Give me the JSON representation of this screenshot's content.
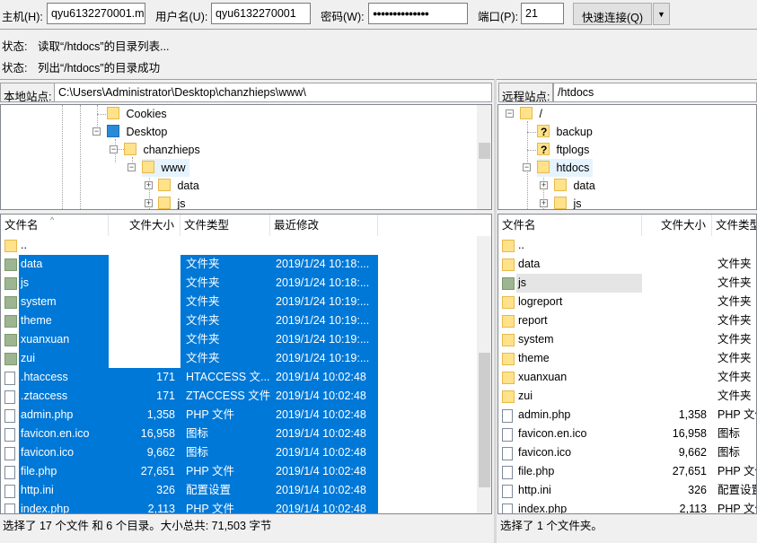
{
  "quickconnect": {
    "host_label": "主机(H):",
    "host_value": "qyu6132270001.m",
    "user_label": "用户名(U):",
    "user_value": "qyu6132270001",
    "pass_label": "密码(W):",
    "pass_value": "●●●●●●●●●●●●●●",
    "port_label": "端口(P):",
    "port_value": "21",
    "connect_button": "快速连接(Q)",
    "dropdown_glyph": "▼"
  },
  "log": [
    {
      "label": "状态:",
      "text": "读取“/htdocs”的目录列表..."
    },
    {
      "label": "状态:",
      "text": "列出“/htdocs”的目录成功"
    }
  ],
  "local": {
    "site_label": "本地站点:",
    "site_path": "C:\\Users\\Administrator\\Desktop\\chanzhieps\\www\\",
    "tree": [
      {
        "name": "Cookies",
        "icon": "folder"
      },
      {
        "name": "Desktop",
        "icon": "folder-blue"
      },
      {
        "name": "chanzhieps",
        "icon": "folder"
      },
      {
        "name": "www",
        "icon": "folder"
      },
      {
        "name": "data",
        "icon": "folder"
      },
      {
        "name": "js",
        "icon": "folder"
      }
    ],
    "columns": [
      "文件名",
      "文件大小",
      "文件类型",
      "最近修改"
    ],
    "files": [
      {
        "name": "..",
        "size": "",
        "type": "",
        "modified": "",
        "icon": "folder",
        "selected": false
      },
      {
        "name": "data",
        "size": "",
        "type": "文件夹",
        "modified": "2019/1/24 10:18:...",
        "icon": "folder-green",
        "selected": true
      },
      {
        "name": "js",
        "size": "",
        "type": "文件夹",
        "modified": "2019/1/24 10:18:...",
        "icon": "folder-green",
        "selected": true
      },
      {
        "name": "system",
        "size": "",
        "type": "文件夹",
        "modified": "2019/1/24 10:19:...",
        "icon": "folder-green",
        "selected": true
      },
      {
        "name": "theme",
        "size": "",
        "type": "文件夹",
        "modified": "2019/1/24 10:19:...",
        "icon": "folder-green",
        "selected": true
      },
      {
        "name": "xuanxuan",
        "size": "",
        "type": "文件夹",
        "modified": "2019/1/24 10:19:...",
        "icon": "folder-green",
        "selected": true
      },
      {
        "name": "zui",
        "size": "",
        "type": "文件夹",
        "modified": "2019/1/24 10:19:...",
        "icon": "folder-green",
        "selected": true
      },
      {
        "name": ".htaccess",
        "size": "171",
        "type": "HTACCESS 文...",
        "modified": "2019/1/4 10:02:48",
        "icon": "file",
        "selected": true
      },
      {
        "name": ".ztaccess",
        "size": "171",
        "type": "ZTACCESS 文件",
        "modified": "2019/1/4 10:02:48",
        "icon": "file",
        "selected": true
      },
      {
        "name": "admin.php",
        "size": "1,358",
        "type": "PHP 文件",
        "modified": "2019/1/4 10:02:48",
        "icon": "file",
        "selected": true
      },
      {
        "name": "favicon.en.ico",
        "size": "16,958",
        "type": "图标",
        "modified": "2019/1/4 10:02:48",
        "icon": "file",
        "selected": true
      },
      {
        "name": "favicon.ico",
        "size": "9,662",
        "type": "图标",
        "modified": "2019/1/4 10:02:48",
        "icon": "file",
        "selected": true
      },
      {
        "name": "file.php",
        "size": "27,651",
        "type": "PHP 文件",
        "modified": "2019/1/4 10:02:48",
        "icon": "file",
        "selected": true
      },
      {
        "name": "http.ini",
        "size": "326",
        "type": "配置设置",
        "modified": "2019/1/4 10:02:48",
        "icon": "file",
        "selected": true
      },
      {
        "name": "index.php",
        "size": "2,113",
        "type": "PHP 文件",
        "modified": "2019/1/4 10:02:48",
        "icon": "file",
        "selected": true
      }
    ],
    "status": "选择了 17 个文件 和 6 个目录。大小总共: 71,503 字节"
  },
  "remote": {
    "site_label": "远程站点:",
    "site_path": "/htdocs",
    "tree": [
      {
        "name": "/",
        "icon": "folder"
      },
      {
        "name": "backup",
        "icon": "folder-question"
      },
      {
        "name": "ftplogs",
        "icon": "folder-question"
      },
      {
        "name": "htdocs",
        "icon": "folder"
      },
      {
        "name": "data",
        "icon": "folder"
      },
      {
        "name": "js",
        "icon": "folder"
      }
    ],
    "columns": [
      "文件名",
      "文件大小",
      "文件类型"
    ],
    "files": [
      {
        "name": "..",
        "size": "",
        "type": "",
        "icon": "folder",
        "selected": false
      },
      {
        "name": "data",
        "size": "",
        "type": "文件夹",
        "icon": "folder",
        "selected": false
      },
      {
        "name": "js",
        "size": "",
        "type": "文件夹",
        "icon": "folder-green",
        "selected": true
      },
      {
        "name": "logreport",
        "size": "",
        "type": "文件夹",
        "icon": "folder",
        "selected": false
      },
      {
        "name": "report",
        "size": "",
        "type": "文件夹",
        "icon": "folder",
        "selected": false
      },
      {
        "name": "system",
        "size": "",
        "type": "文件夹",
        "icon": "folder",
        "selected": false
      },
      {
        "name": "theme",
        "size": "",
        "type": "文件夹",
        "icon": "folder",
        "selected": false
      },
      {
        "name": "xuanxuan",
        "size": "",
        "type": "文件夹",
        "icon": "folder",
        "selected": false
      },
      {
        "name": "zui",
        "size": "",
        "type": "文件夹",
        "icon": "folder",
        "selected": false
      },
      {
        "name": "admin.php",
        "size": "1,358",
        "type": "PHP 文件",
        "icon": "file",
        "selected": false
      },
      {
        "name": "favicon.en.ico",
        "size": "16,958",
        "type": "图标",
        "icon": "file",
        "selected": false
      },
      {
        "name": "favicon.ico",
        "size": "9,662",
        "type": "图标",
        "icon": "file",
        "selected": false
      },
      {
        "name": "file.php",
        "size": "27,651",
        "type": "PHP 文件",
        "icon": "file",
        "selected": false
      },
      {
        "name": "http.ini",
        "size": "326",
        "type": "配置设置",
        "icon": "file",
        "selected": false
      },
      {
        "name": "index.php",
        "size": "2,113",
        "type": "PHP 文件",
        "icon": "file",
        "selected": false
      }
    ],
    "status": "选择了 1 个文件夹。"
  },
  "colors": {
    "selection": "#0078d7",
    "folder": "#ffe28a",
    "hover_row": "#e5e5e5"
  }
}
